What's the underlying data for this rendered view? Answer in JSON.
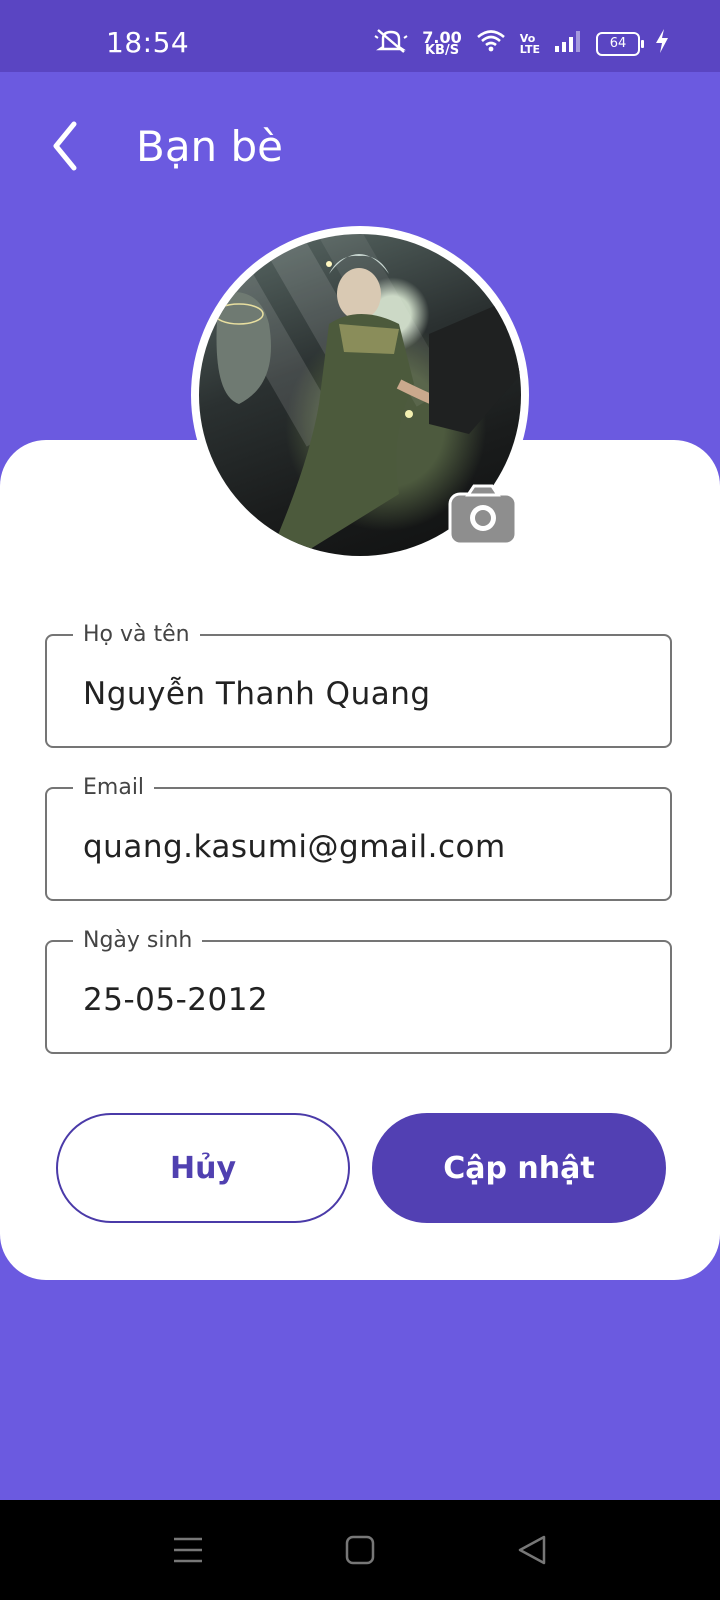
{
  "status_bar": {
    "time": "18:54",
    "net_speed_value": "7.00",
    "net_speed_unit": "KB/S",
    "volte_top": "Vo",
    "volte_bottom": "LTE",
    "battery": "64"
  },
  "header": {
    "title": "Bạn bè"
  },
  "form": {
    "name_label": "Họ và tên",
    "name_value": "Nguyễn Thanh Quang",
    "email_label": "Email",
    "email_value": "quang.kasumi@gmail.com",
    "dob_label": "Ngày sinh",
    "dob_value": "25-05-2012"
  },
  "actions": {
    "cancel_label": "Hủy",
    "update_label": "Cập nhật"
  },
  "colors": {
    "background": "#6b5ae0",
    "status_bar": "#5a45c2",
    "primary": "#5240b3"
  },
  "icons": [
    "back-arrow-icon",
    "camera-icon",
    "mute-icon",
    "wifi-icon",
    "signal-icon",
    "battery-icon",
    "charging-icon",
    "menu-icon",
    "home-icon",
    "back-triangle-icon"
  ]
}
